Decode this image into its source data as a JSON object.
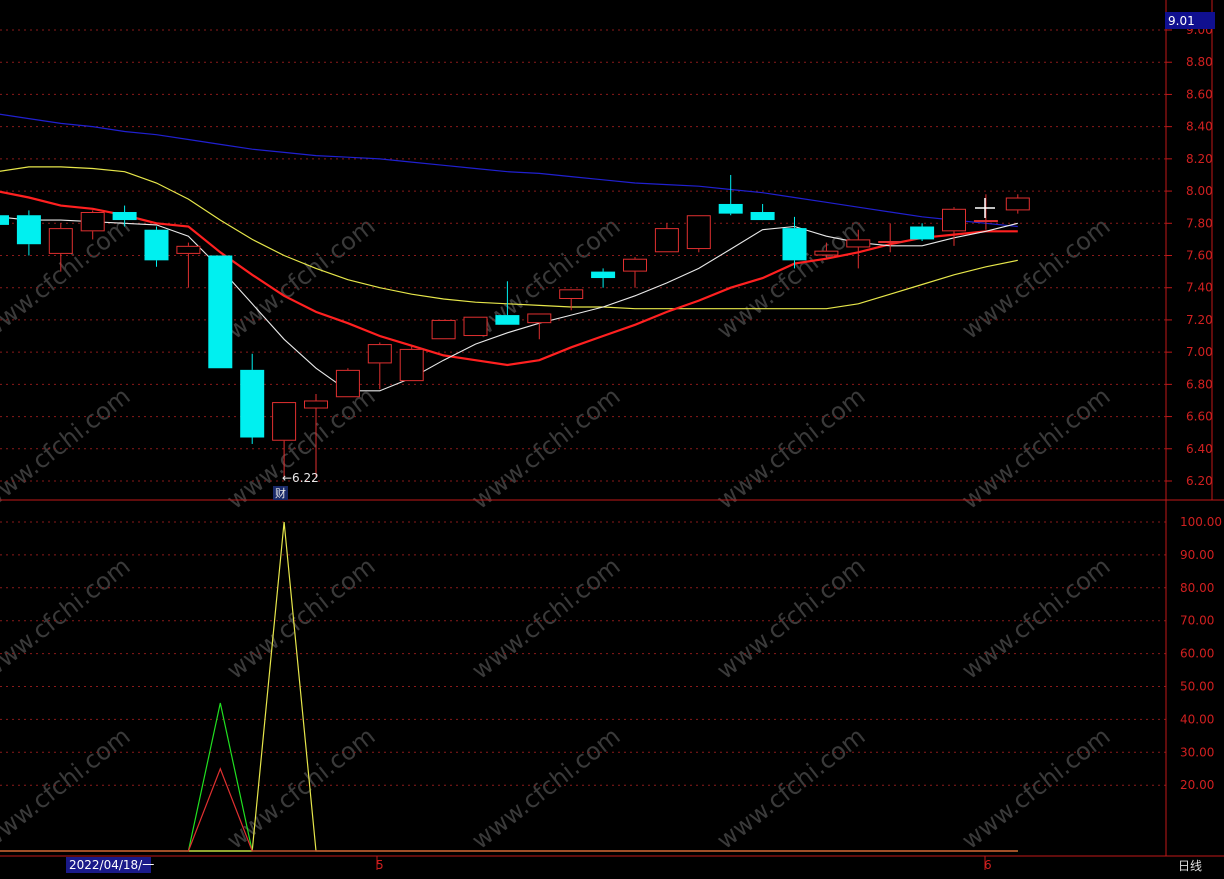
{
  "chart_data": [
    {
      "type": "candlestick",
      "period_label": "日线",
      "date_label": "2022/04/18/一",
      "x_markers": [
        "5",
        "6"
      ],
      "current_price_label": "9.01",
      "low_annotation": "←6.22",
      "finance_badge": "财",
      "yticks": [
        "9.00",
        "8.80",
        "8.60",
        "8.40",
        "8.20",
        "8.00",
        "7.80",
        "7.60",
        "7.40",
        "7.20",
        "7.00",
        "6.80",
        "6.60",
        "6.40",
        "6.20"
      ],
      "ylim": [
        6.1,
        9.05
      ],
      "colors": {
        "up": "#e03030",
        "down": "#00f0f0",
        "ma_white": "#e8e8e8",
        "ma_red": "#ff2020",
        "ma_yellow": "#e6e64a",
        "ma_blue": "#2020d0"
      },
      "candles": [
        {
          "o": 7.85,
          "h": 7.88,
          "l": 7.76,
          "c": 7.79
        },
        {
          "o": 7.85,
          "h": 7.88,
          "l": 7.6,
          "c": 7.67
        },
        {
          "o": 7.61,
          "h": 7.8,
          "l": 7.5,
          "c": 7.77
        },
        {
          "o": 7.75,
          "h": 7.88,
          "l": 7.7,
          "c": 7.87
        },
        {
          "o": 7.87,
          "h": 7.91,
          "l": 7.78,
          "c": 7.82
        },
        {
          "o": 7.76,
          "h": 7.78,
          "l": 7.53,
          "c": 7.57
        },
        {
          "o": 7.61,
          "h": 7.68,
          "l": 7.4,
          "c": 7.66
        },
        {
          "o": 7.6,
          "h": 7.6,
          "l": 6.9,
          "c": 6.9
        },
        {
          "o": 6.89,
          "h": 6.99,
          "l": 6.43,
          "c": 6.47
        },
        {
          "o": 6.45,
          "h": 6.69,
          "l": 6.22,
          "c": 6.69
        },
        {
          "o": 6.65,
          "h": 6.74,
          "l": 6.22,
          "c": 6.7
        },
        {
          "o": 6.72,
          "h": 6.9,
          "l": 6.72,
          "c": 6.89
        },
        {
          "o": 6.93,
          "h": 7.06,
          "l": 6.77,
          "c": 7.05
        },
        {
          "o": 6.82,
          "h": 7.04,
          "l": 6.82,
          "c": 7.02
        },
        {
          "o": 7.08,
          "h": 7.2,
          "l": 7.08,
          "c": 7.2
        },
        {
          "o": 7.1,
          "h": 7.22,
          "l": 7.1,
          "c": 7.22
        },
        {
          "o": 7.23,
          "h": 7.44,
          "l": 7.17,
          "c": 7.17
        },
        {
          "o": 7.18,
          "h": 7.24,
          "l": 7.08,
          "c": 7.24
        },
        {
          "o": 7.33,
          "h": 7.39,
          "l": 7.26,
          "c": 7.39
        },
        {
          "o": 7.5,
          "h": 7.52,
          "l": 7.4,
          "c": 7.46
        },
        {
          "o": 7.5,
          "h": 7.59,
          "l": 7.4,
          "c": 7.58
        },
        {
          "o": 7.62,
          "h": 7.8,
          "l": 7.62,
          "c": 7.77
        },
        {
          "o": 7.64,
          "h": 7.85,
          "l": 7.62,
          "c": 7.85
        },
        {
          "o": 7.92,
          "h": 8.1,
          "l": 7.85,
          "c": 7.86
        },
        {
          "o": 7.87,
          "h": 7.92,
          "l": 7.83,
          "c": 7.82
        },
        {
          "o": 7.77,
          "h": 7.84,
          "l": 7.52,
          "c": 7.57
        },
        {
          "o": 7.6,
          "h": 7.68,
          "l": 7.58,
          "c": 7.63
        },
        {
          "o": 7.65,
          "h": 7.76,
          "l": 7.52,
          "c": 7.7
        },
        {
          "o": 7.68,
          "h": 7.8,
          "l": 7.62,
          "c": 7.69
        },
        {
          "o": 7.78,
          "h": 7.8,
          "l": 7.69,
          "c": 7.7
        },
        {
          "o": 7.75,
          "h": 7.9,
          "l": 7.66,
          "c": 7.89
        },
        {
          "o": 7.82,
          "h": 7.98,
          "l": 7.76,
          "c": 7.82
        },
        {
          "o": 7.88,
          "h": 7.98,
          "l": 7.86,
          "c": 7.96
        }
      ],
      "ma_white": [
        7.84,
        7.82,
        7.82,
        7.81,
        7.8,
        7.79,
        7.72,
        7.52,
        7.3,
        7.08,
        6.9,
        6.76,
        6.76,
        6.84,
        6.95,
        7.05,
        7.12,
        7.18,
        7.23,
        7.28,
        7.35,
        7.43,
        7.52,
        7.64,
        7.76,
        7.78,
        7.72,
        7.68,
        7.66,
        7.66,
        7.71,
        7.75,
        7.8
      ],
      "ma_red": [
        8.0,
        7.96,
        7.91,
        7.89,
        7.85,
        7.8,
        7.78,
        7.62,
        7.48,
        7.35,
        7.25,
        7.18,
        7.1,
        7.04,
        6.98,
        6.95,
        6.92,
        6.95,
        7.03,
        7.1,
        7.17,
        7.25,
        7.32,
        7.4,
        7.46,
        7.55,
        7.58,
        7.62,
        7.67,
        7.71,
        7.73,
        7.75,
        7.75
      ],
      "ma_yellow": [
        8.12,
        8.15,
        8.15,
        8.14,
        8.12,
        8.05,
        7.95,
        7.82,
        7.7,
        7.6,
        7.52,
        7.45,
        7.4,
        7.36,
        7.33,
        7.31,
        7.3,
        7.29,
        7.28,
        7.28,
        7.27,
        7.27,
        7.27,
        7.27,
        7.27,
        7.27,
        7.27,
        7.3,
        7.36,
        7.42,
        7.48,
        7.53,
        7.57
      ],
      "ma_blue": [
        8.48,
        8.45,
        8.42,
        8.4,
        8.37,
        8.35,
        8.32,
        8.29,
        8.26,
        8.24,
        8.22,
        8.21,
        8.2,
        8.18,
        8.16,
        8.14,
        8.12,
        8.11,
        8.09,
        8.07,
        8.05,
        8.04,
        8.03,
        8.01,
        7.99,
        7.96,
        7.93,
        7.9,
        7.87,
        7.84,
        7.82,
        7.8,
        7.78
      ]
    },
    {
      "type": "line",
      "yticks": [
        "100.00",
        "90.00",
        "80.00",
        "70.00",
        "60.00",
        "50.00",
        "40.00",
        "30.00",
        "20.00"
      ],
      "ylim": [
        0,
        105
      ],
      "series": [
        {
          "color": "#e6e64a",
          "values": [
            0,
            0,
            0,
            0,
            0,
            0,
            0,
            0,
            0,
            100,
            0,
            0,
            0,
            0,
            0,
            0,
            0,
            0,
            0,
            0,
            0,
            0,
            0,
            0,
            0,
            0,
            0,
            0,
            0,
            0,
            0,
            0,
            0
          ]
        },
        {
          "color": "#20e020",
          "values": [
            0,
            0,
            0,
            0,
            0,
            0,
            0,
            45,
            0,
            0,
            0,
            0,
            0,
            0,
            0,
            0,
            0,
            0,
            0,
            0,
            0,
            0,
            0,
            0,
            0,
            0,
            0,
            0,
            0,
            0,
            0,
            0,
            0
          ]
        },
        {
          "color": "#e03030",
          "values": [
            0,
            0,
            0,
            0,
            0,
            0,
            0,
            25,
            0,
            0,
            0,
            0,
            0,
            0,
            0,
            0,
            0,
            0,
            0,
            0,
            0,
            0,
            0,
            0,
            0,
            0,
            0,
            0,
            0,
            0,
            0,
            0,
            0
          ]
        }
      ]
    }
  ],
  "watermark": "www.cfchi.com"
}
